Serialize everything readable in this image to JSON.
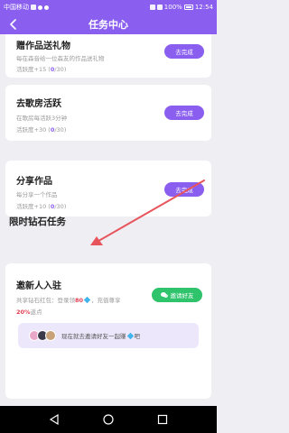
{
  "status_bar": {
    "carrier": "中国移动",
    "battery": "100%",
    "time": "12:54"
  },
  "header": {
    "title": "任务中心"
  },
  "tasks": [
    {
      "title": "赠作品送礼物",
      "desc": "每在森音给一位森友的作品送礼物",
      "reward_prefix": "活跃度+15 (",
      "progress_done": "0",
      "progress_total": "/30)",
      "button": "去完成"
    },
    {
      "title": "去歌房活跃",
      "desc": "在歌房每活跃3分钟",
      "reward_prefix": "活跃度+30 (",
      "progress_done": "0",
      "progress_total": "/30)",
      "button": "去完成"
    },
    {
      "title": "分享作品",
      "desc": "每分享一个作品",
      "reward_prefix": "活跃度+10 (",
      "progress_done": "0",
      "progress_total": "/30)",
      "button": "去完成"
    }
  ],
  "limited_section": {
    "title": "限时钻石任务",
    "invite": {
      "title": "邀新人入驻",
      "line1_prefix": "共享钻石红包：登录领",
      "line1_amount": "80",
      "line1_suffix": "，充值尊享",
      "line2_percent": "20%",
      "line2_suffix": "返点",
      "button": "邀请好友",
      "banner_text": "现在就去邀请好友一起赚",
      "banner_suffix": "吧"
    }
  },
  "colors": {
    "accent": "#8a5ff0",
    "highlight": "#e23d52",
    "invite_button": "#2fc36b",
    "arrow": "#e8545c"
  }
}
